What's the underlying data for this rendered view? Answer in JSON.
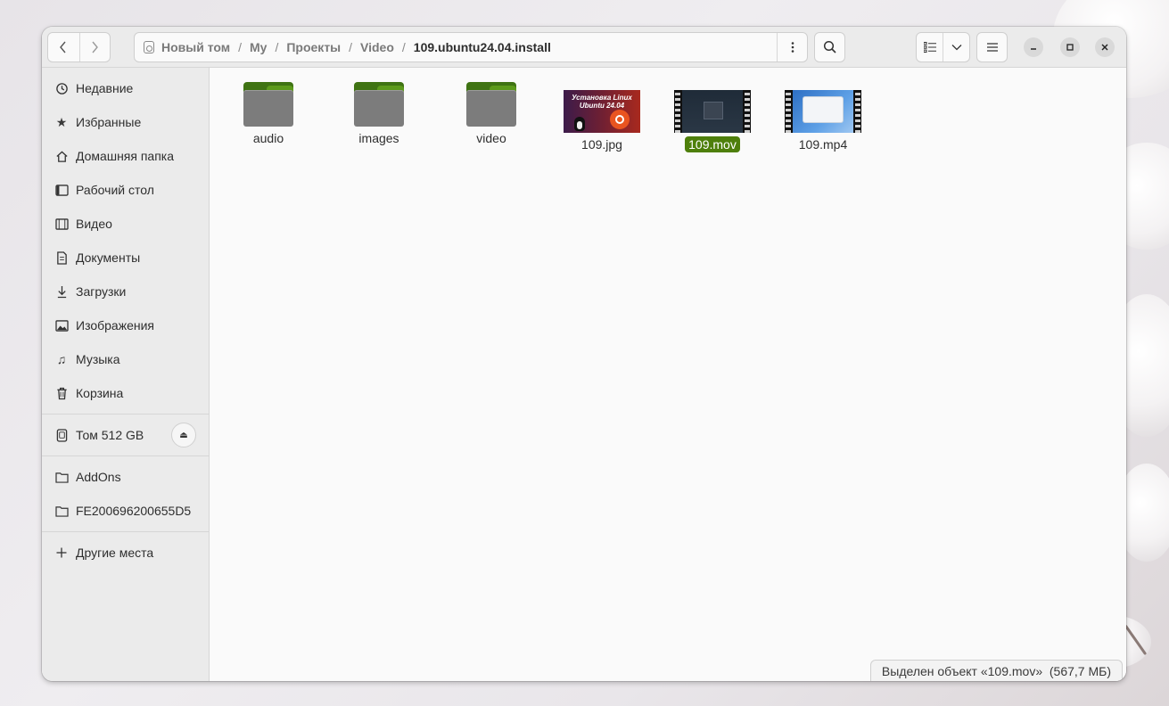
{
  "path": {
    "segments": [
      "Новый том",
      "My",
      "Проекты",
      "Video",
      "109.ubuntu24.04.install"
    ]
  },
  "sidebar": {
    "places": [
      {
        "label": "Недавние",
        "icon": "clock-icon"
      },
      {
        "label": "Избранные",
        "icon": "star-icon"
      },
      {
        "label": "Домашняя папка",
        "icon": "home-icon"
      },
      {
        "label": "Рабочий стол",
        "icon": "desktop-icon"
      },
      {
        "label": "Видео",
        "icon": "film-icon"
      },
      {
        "label": "Документы",
        "icon": "document-icon"
      },
      {
        "label": "Загрузки",
        "icon": "download-icon"
      },
      {
        "label": "Изображения",
        "icon": "image-icon"
      },
      {
        "label": "Музыка",
        "icon": "music-icon"
      },
      {
        "label": "Корзина",
        "icon": "trash-icon"
      }
    ],
    "volume": {
      "label": "Том 512 GB",
      "icon": "drive-icon"
    },
    "bookmarks": [
      {
        "label": "AddOns",
        "icon": "folder-icon"
      },
      {
        "label": "FE200696200655D5",
        "icon": "folder-icon"
      }
    ],
    "other": {
      "label": "Другие места",
      "icon": "plus-icon"
    }
  },
  "files": [
    {
      "name": "audio",
      "kind": "folder"
    },
    {
      "name": "images",
      "kind": "folder"
    },
    {
      "name": "video",
      "kind": "folder"
    },
    {
      "name": "109.jpg",
      "kind": "image",
      "thumb_text": "Установка Linux Ubuntu 24.04"
    },
    {
      "name": "109.mov",
      "kind": "video",
      "selected": true
    },
    {
      "name": "109.mp4",
      "kind": "video"
    }
  ],
  "status": {
    "text": "Выделен объект «109.mov»  (567,7 МБ)"
  },
  "colors": {
    "accent": "#4e7f0b",
    "folder_tab": "#3f7313"
  }
}
